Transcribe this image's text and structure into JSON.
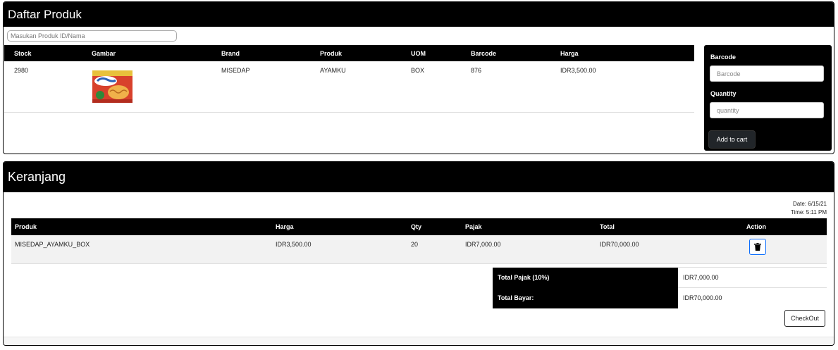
{
  "products_panel": {
    "title": "Daftar Produk",
    "search_placeholder": "Masukan Produk ID/Nama",
    "columns": [
      "Stock",
      "Gambar",
      "Brand",
      "Produk",
      "UOM",
      "Barcode",
      "Harga"
    ],
    "rows": [
      {
        "stock": "2980",
        "image_icon": "sedaap-noodle-pack-image",
        "brand": "MISEDAP",
        "produk": "AYAMKU",
        "uom": "BOX",
        "barcode": "876",
        "harga": "IDR3,500.00"
      }
    ]
  },
  "cart_form": {
    "barcode_label": "Barcode",
    "barcode_placeholder": "Barcode",
    "quantity_label": "Quantity",
    "quantity_placeholder": "quantity",
    "add_button": "Add to cart"
  },
  "cart_panel": {
    "title": "Keranjang",
    "date": "Date: 6/15/21",
    "time": "Time: 5:11 PM",
    "columns": [
      "Produk",
      "Harga",
      "Qty",
      "Pajak",
      "Total",
      "Action"
    ],
    "rows": [
      {
        "produk": "MISEDAP_AYAMKU_BOX",
        "harga": "IDR3,500.00",
        "qty": "20",
        "pajak": "IDR7,000.00",
        "total": "IDR70,000.00",
        "action_icon": "trash-icon"
      }
    ],
    "total_pajak_label": "Total Pajak (10%)",
    "total_pajak_value": "IDR7,000.00",
    "total_bayar_label": "Total Bayar:",
    "total_bayar_value": "IDR70,000.00",
    "checkout_button": "CheckOut"
  },
  "colors": {
    "header_bg": "#000000",
    "accent_blue": "#0d6efd",
    "row_stripe": "#f2f2f2"
  }
}
